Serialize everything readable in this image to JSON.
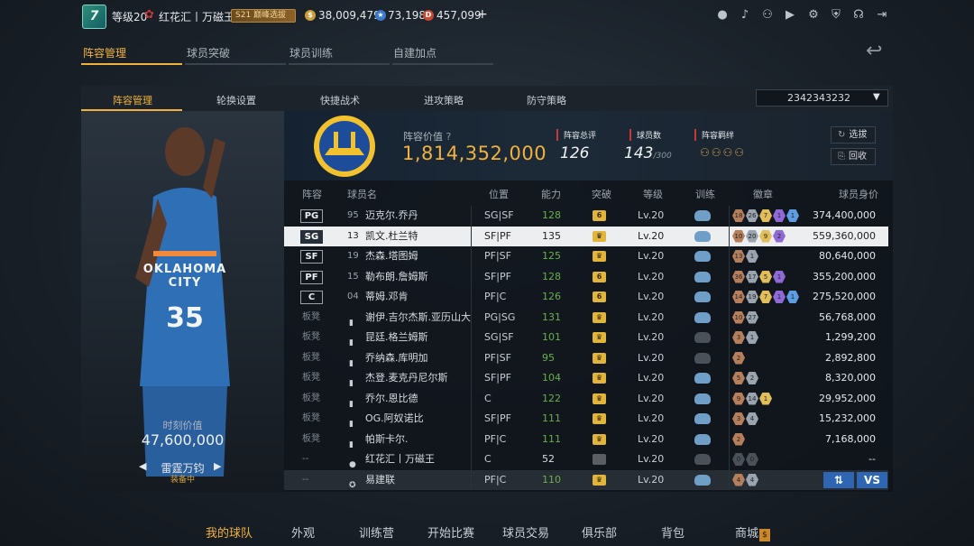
{
  "topbar": {
    "avatar_text": "7",
    "level": "等级20",
    "club": "红花汇丨万磁王",
    "rank_badge": "S21 巅峰选拔",
    "gold": "38,009,479",
    "points": "73,198",
    "diamonds": "457,099",
    "plus": "+",
    "icons": [
      "user-icon",
      "bell-icon",
      "friends-icon",
      "video-icon",
      "gear-icon",
      "shield-icon",
      "headset-icon",
      "exit-icon"
    ]
  },
  "main_tabs": [
    {
      "label": "阵容管理",
      "active": true
    },
    {
      "label": "球员突破",
      "active": false
    },
    {
      "label": "球员训练",
      "active": false
    },
    {
      "label": "自建加点",
      "active": false
    }
  ],
  "sub_tabs": [
    {
      "label": "阵容管理",
      "active": true
    },
    {
      "label": "轮换设置",
      "active": false
    },
    {
      "label": "快捷战术",
      "active": false
    },
    {
      "label": "进攻策略",
      "active": false
    },
    {
      "label": "防守策略",
      "active": false
    }
  ],
  "lineup_select": "2342343232",
  "player_card": {
    "jersey_team": "OKLAHOMA CITY",
    "jersey_number": "35",
    "market_value_label": "时刻价值",
    "market_value": "47,600,000",
    "skin_name": "雷霆万钧",
    "skin_status": "装备中"
  },
  "team": {
    "value_label": "阵容价值",
    "value": "1,814,352,000",
    "rating_label": "阵容总评",
    "rating": "126",
    "count_label": "球员数",
    "count": "143",
    "count_max": "/300",
    "bond_label": "阵容羁绊",
    "buttons": {
      "pick": "选拔",
      "recycle": "回收"
    }
  },
  "columns": [
    "阵容",
    "球员名",
    "位置",
    "能力",
    "突破",
    "等级",
    "训练",
    "徽章",
    "球员身价"
  ],
  "rows": [
    {
      "slot": "PG",
      "num": "95",
      "name": "迈克尔.乔丹",
      "pos": "SG|SF",
      "ability": "128",
      "bk": "6",
      "lv": "Lv.20",
      "badges": [
        "18",
        "26",
        "7",
        "1",
        "1"
      ],
      "value": "374,400,000"
    },
    {
      "slot": "SG",
      "num": "13",
      "name": "凯文.杜兰特",
      "pos": "SF|PF",
      "ability": "135",
      "bk": "♛",
      "lv": "Lv.20",
      "badges": [
        "10",
        "20",
        "9",
        "2"
      ],
      "value": "559,360,000",
      "selected": true
    },
    {
      "slot": "SF",
      "num": "19",
      "name": "杰森.塔图姆",
      "pos": "PF|SF",
      "ability": "125",
      "bk": "♛",
      "lv": "Lv.20",
      "badges": [
        "13",
        "1"
      ],
      "value": "80,640,000"
    },
    {
      "slot": "PF",
      "num": "15",
      "name": "勒布朗.詹姆斯",
      "pos": "SF|PF",
      "ability": "128",
      "bk": "6",
      "lv": "Lv.20",
      "badges": [
        "36",
        "17",
        "5",
        "1"
      ],
      "value": "355,200,000"
    },
    {
      "slot": "C",
      "num": "04",
      "name": "蒂姆.邓肯",
      "pos": "PF|C",
      "ability": "126",
      "bk": "6",
      "lv": "Lv.20",
      "badges": [
        "14",
        "19",
        "7",
        "1",
        "1"
      ],
      "value": "275,520,000"
    },
    {
      "slot": "板凳",
      "num": "",
      "name": "谢伊.吉尔杰斯.亚历山大",
      "pos": "PG|SG",
      "ability": "131",
      "bk": "♛",
      "lv": "Lv.20",
      "badges": [
        "10",
        "27"
      ],
      "value": "56,768,000"
    },
    {
      "slot": "板凳",
      "num": "",
      "name": "昆廷.格兰姆斯",
      "pos": "SG|SF",
      "ability": "101",
      "bk": "♛",
      "lv": "Lv.20",
      "badges": [
        "3",
        "1"
      ],
      "value": "1,299,200"
    },
    {
      "slot": "板凳",
      "num": "",
      "name": "乔纳森.库明加",
      "pos": "PF|SF",
      "ability": "95",
      "bk": "♛",
      "lv": "Lv.20",
      "badges": [
        "2"
      ],
      "value": "2,892,800"
    },
    {
      "slot": "板凳",
      "num": "",
      "name": "杰登.麦克丹尼尔斯",
      "pos": "SF|PF",
      "ability": "104",
      "bk": "♛",
      "lv": "Lv.20",
      "badges": [
        "5",
        "2"
      ],
      "value": "8,320,000"
    },
    {
      "slot": "板凳",
      "num": "",
      "name": "乔尔.恩比德",
      "pos": "C",
      "ability": "122",
      "bk": "♛",
      "lv": "Lv.20",
      "badges": [
        "9",
        "14",
        "1"
      ],
      "value": "29,952,000"
    },
    {
      "slot": "板凳",
      "num": "",
      "name": "OG.阿奴诺比",
      "pos": "SF|PF",
      "ability": "111",
      "bk": "♛",
      "lv": "Lv.20",
      "badges": [
        "3",
        "4"
      ],
      "value": "15,232,000"
    },
    {
      "slot": "板凳",
      "num": "",
      "name": "帕斯卡尔.",
      "pos": "PF|C",
      "ability": "111",
      "bk": "♛",
      "lv": "Lv.20",
      "badges": [
        "2"
      ],
      "value": "7,168,000"
    },
    {
      "slot": "--",
      "num": "",
      "name": "红花汇丨万磁王",
      "pos": "C",
      "ability": "52",
      "bk": "",
      "lv": "Lv.20",
      "badges": [
        "0",
        "0"
      ],
      "value": "--",
      "dim": true
    },
    {
      "slot": "--",
      "num": "",
      "name": "易建联",
      "pos": "PF|C",
      "ability": "110",
      "bk": "♛",
      "lv": "Lv.20",
      "badges": [
        "4",
        "4"
      ],
      "value": "",
      "last": true
    }
  ],
  "action_buttons": {
    "swap": "⇅",
    "vs": "VS"
  },
  "bottom_nav": [
    {
      "label": "我的球队",
      "active": true
    },
    {
      "label": "外观",
      "active": false
    },
    {
      "label": "训练营",
      "active": false
    },
    {
      "label": "开始比赛",
      "active": false
    },
    {
      "label": "球员交易",
      "active": false
    },
    {
      "label": "俱乐部",
      "active": false
    },
    {
      "label": "背包",
      "active": false
    },
    {
      "label": "商城",
      "active": false
    }
  ],
  "colors": {
    "accent": "#f0b23c",
    "ability_green": "#67b04d",
    "alert_red": "#c53a36",
    "button_blue": "#2e66b3"
  }
}
